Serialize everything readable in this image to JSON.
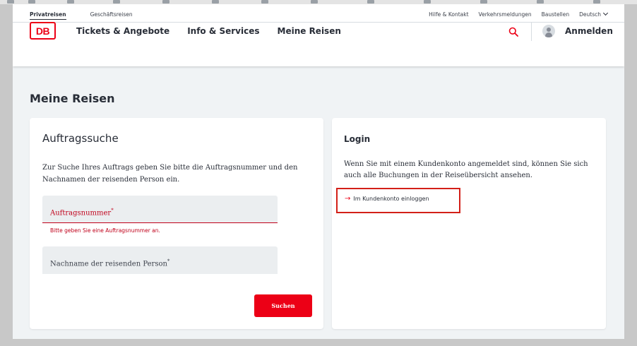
{
  "meta_nav": {
    "tabs": [
      {
        "label": "Privatreisen",
        "active": true
      },
      {
        "label": "Geschäftsreisen",
        "active": false
      }
    ],
    "links": [
      "Hilfe & Kontakt",
      "Verkehrsmeldungen",
      "Baustellen"
    ],
    "language": "Deutsch"
  },
  "header": {
    "logo": "DB",
    "nav": [
      "Tickets & Angebote",
      "Info & Services",
      "Meine Reisen"
    ],
    "login_label": "Anmelden"
  },
  "page": {
    "title": "Meine Reisen"
  },
  "search_card": {
    "title": "Auftragssuche",
    "description": "Zur Suche Ihres Auftrags geben Sie bitte die Auftragsnummer und den Nachnamen der reisenden Person ein.",
    "order_field_label": "Auftragsnummer",
    "order_field_error": "Bitte geben Sie eine Auftragsnummer an.",
    "name_field_label": "Nachname der reisenden Person",
    "required_mark": "*",
    "submit_label": "Suchen"
  },
  "login_card": {
    "title": "Login",
    "description": "Wenn Sie mit einem Kundenkonto angemeldet sind, können Sie sich auch alle Buchungen in der Reiseübersicht ansehen.",
    "link_label": "Im Kundenkonto einloggen",
    "link_arrow": "→"
  },
  "colors": {
    "brand_red": "#ec0016",
    "error_red": "#c0001a",
    "highlight_red": "#d32018",
    "background": "#f0f3f5"
  }
}
